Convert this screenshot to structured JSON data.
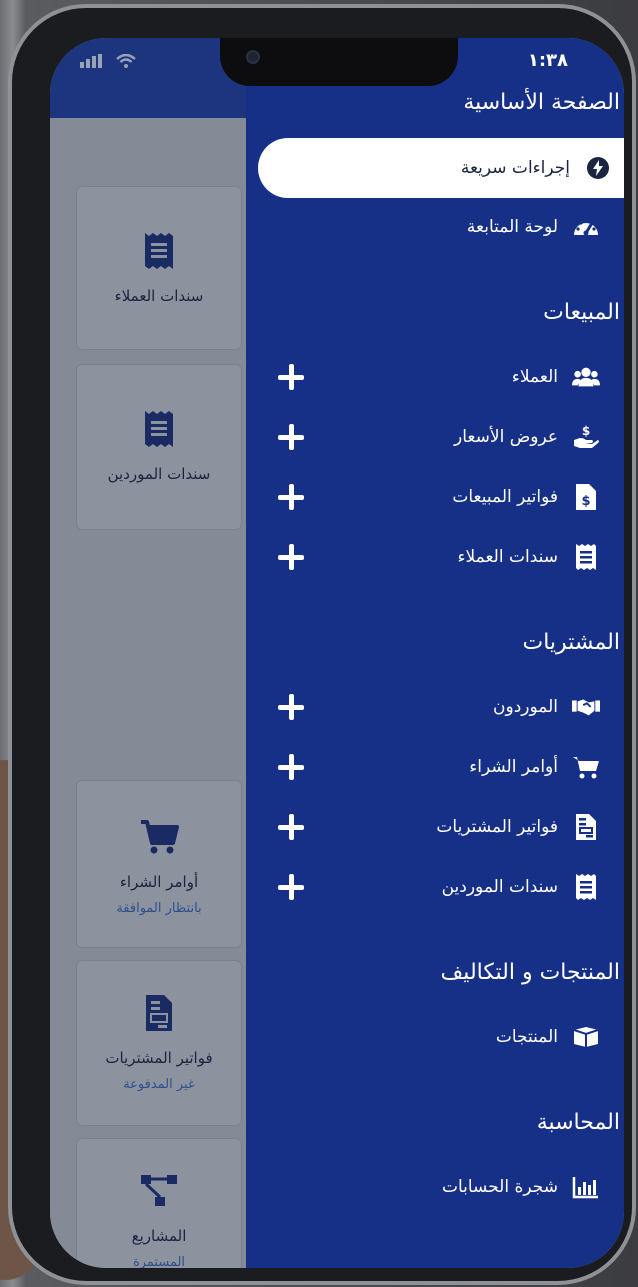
{
  "status": {
    "time": "١:٣٨"
  },
  "drawer": {
    "home_title": "الصفحة الأساسية",
    "home_items": [
      {
        "label": "إجراءات سريعة",
        "icon": "bolt-icon",
        "active": true
      },
      {
        "label": "لوحة المتابعة",
        "icon": "speedometer-icon",
        "active": false
      }
    ],
    "sales_title": "المبيعات",
    "sales_items": [
      {
        "label": "العملاء",
        "icon": "users-icon"
      },
      {
        "label": "عروض الأسعار",
        "icon": "hand-dollar-icon"
      },
      {
        "label": "فواتير المبيعات",
        "icon": "invoice-dollar-icon"
      },
      {
        "label": "سندات العملاء",
        "icon": "receipt-icon"
      }
    ],
    "purchases_title": "المشتريات",
    "purchases_items": [
      {
        "label": "الموردون",
        "icon": "handshake-icon"
      },
      {
        "label": "أوامر الشراء",
        "icon": "cart-icon"
      },
      {
        "label": "فواتير المشتريات",
        "icon": "invoice-icon"
      },
      {
        "label": "سندات الموردين",
        "icon": "receipt-icon"
      }
    ],
    "products_title": "المنتجات و التكاليف",
    "products_items": [
      {
        "label": "المنتجات",
        "icon": "box-icon"
      }
    ],
    "accounting_title": "المحاسبة",
    "accounting_items": [
      {
        "label": "شجرة الحسابات",
        "icon": "chart-bars-icon"
      }
    ]
  },
  "dashboard": {
    "tiles": [
      {
        "label": "سندات العملاء",
        "sub": "",
        "icon": "receipt-icon"
      },
      {
        "label": "سندات الموردين",
        "sub": "",
        "icon": "receipt-icon"
      },
      {
        "label": "أوامر الشراء",
        "sub": "بانتظار الموافقة",
        "icon": "cart-icon"
      },
      {
        "label": "فواتير المشتريات",
        "sub": "غير المدفوعة",
        "icon": "invoice-icon"
      },
      {
        "label": "المشاريع",
        "sub": "المستمرة",
        "icon": "sitemap-icon"
      }
    ]
  },
  "colors": {
    "drawer_bg": "#173087",
    "active_bg": "#ffffff",
    "tile_icon": "#1a2b63"
  }
}
